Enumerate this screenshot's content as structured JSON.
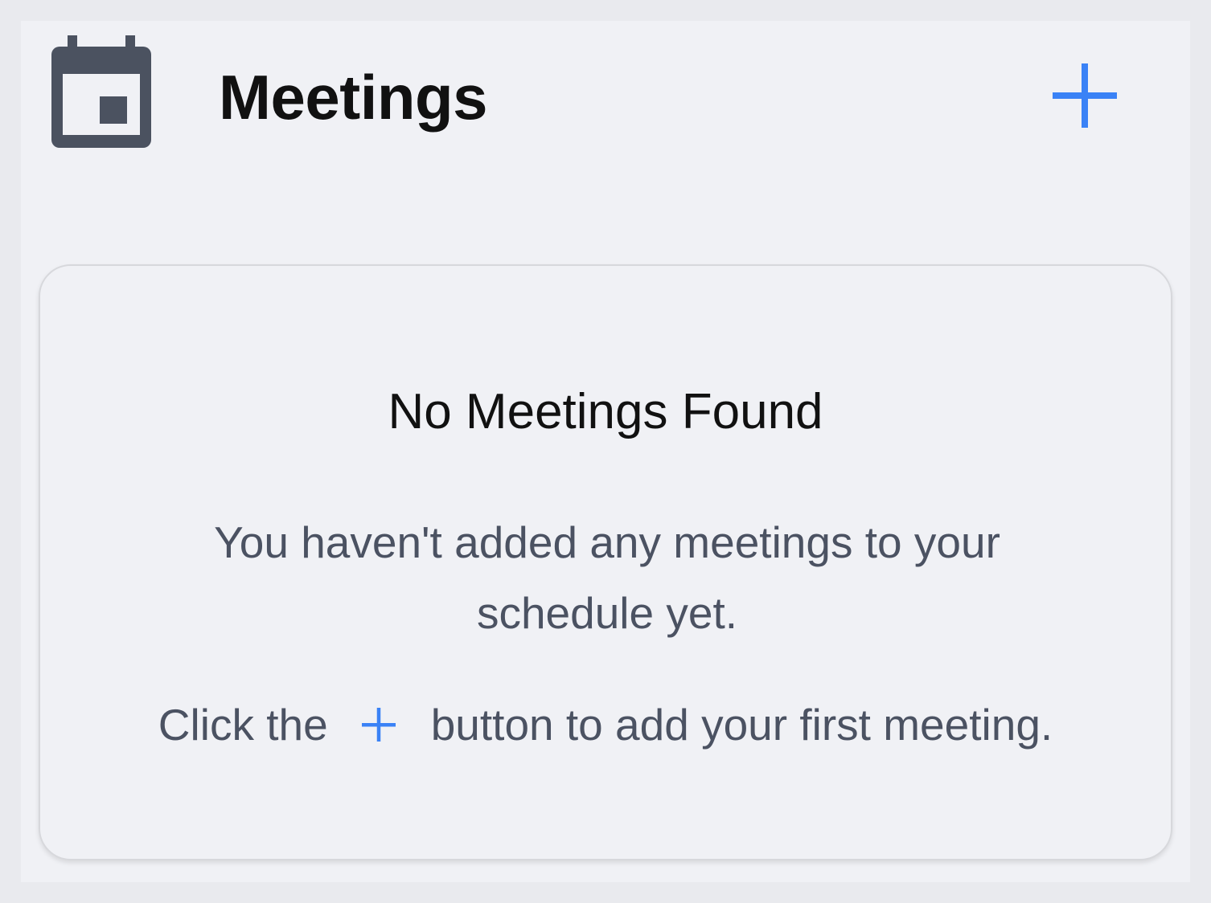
{
  "header": {
    "title": "Meetings",
    "icon": "calendar-icon",
    "add_icon": "plus-icon"
  },
  "empty_state": {
    "title": "No Meetings Found",
    "description": "You haven't added any meetings to your schedule yet.",
    "hint_before": "Click the",
    "hint_after": "button to add your first meeting.",
    "hint_icon": "plus-icon"
  },
  "colors": {
    "accent": "#3a82f6",
    "icon": "#4b5260",
    "background": "#f0f1f5",
    "outer_background": "#e9eaee"
  }
}
